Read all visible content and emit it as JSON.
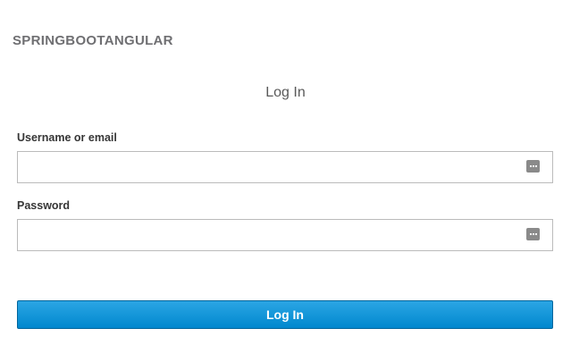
{
  "header": {
    "brand": "SPRINGBOOTANGULAR"
  },
  "form": {
    "title": "Log In",
    "username": {
      "label": "Username or email",
      "value": "",
      "icon": "password-manager-icon"
    },
    "password": {
      "label": "Password",
      "value": "",
      "icon": "password-manager-icon"
    },
    "submit_label": "Log In"
  },
  "colors": {
    "brand_text": "#6f6f72",
    "button": "#0088ce",
    "field_border": "#bbbbbb"
  }
}
